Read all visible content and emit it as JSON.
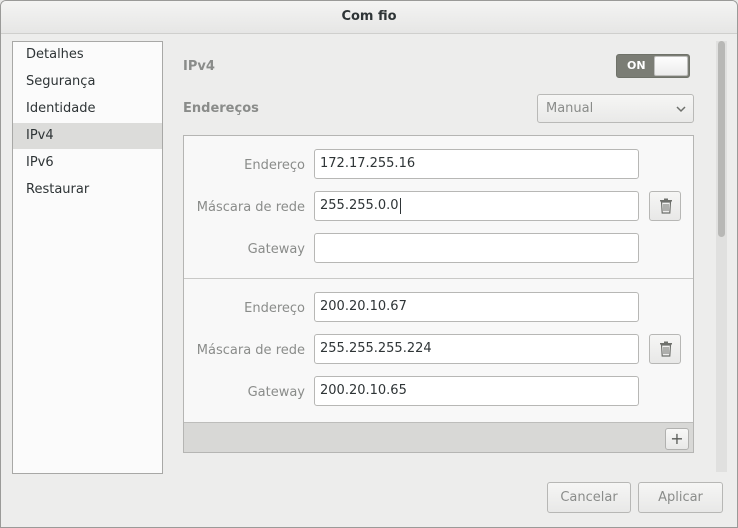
{
  "window": {
    "title": "Com fio"
  },
  "sidebar": {
    "items": [
      {
        "label": "Detalhes"
      },
      {
        "label": "Segurança"
      },
      {
        "label": "Identidade"
      },
      {
        "label": "IPv4",
        "selected": true
      },
      {
        "label": "IPv6"
      },
      {
        "label": "Restaurar"
      }
    ]
  },
  "ipv4": {
    "section_label": "IPv4",
    "toggle": {
      "label": "ON",
      "state": true
    },
    "addresses_label": "Endereços",
    "method": {
      "selected": "Manual"
    }
  },
  "address_entries": [
    {
      "address_label": "Endereço",
      "address": "172.17.255.16",
      "netmask_label": "Máscara de rede",
      "netmask": "255.255.0.0",
      "gateway_label": "Gateway",
      "gateway": ""
    },
    {
      "address_label": "Endereço",
      "address": "200.20.10.67",
      "netmask_label": "Máscara de rede",
      "netmask": "255.255.255.224",
      "gateway_label": "Gateway",
      "gateway": "200.20.10.65"
    }
  ],
  "footer": {
    "cancel_label": "Cancelar",
    "apply_label": "Aplicar"
  },
  "icons": {
    "delete": "trash-icon",
    "add": "plus-icon",
    "dropdown": "chevron-down-icon"
  },
  "colors": {
    "toggle_on": "#7b7d75",
    "selected_row": "#dcdcda"
  }
}
